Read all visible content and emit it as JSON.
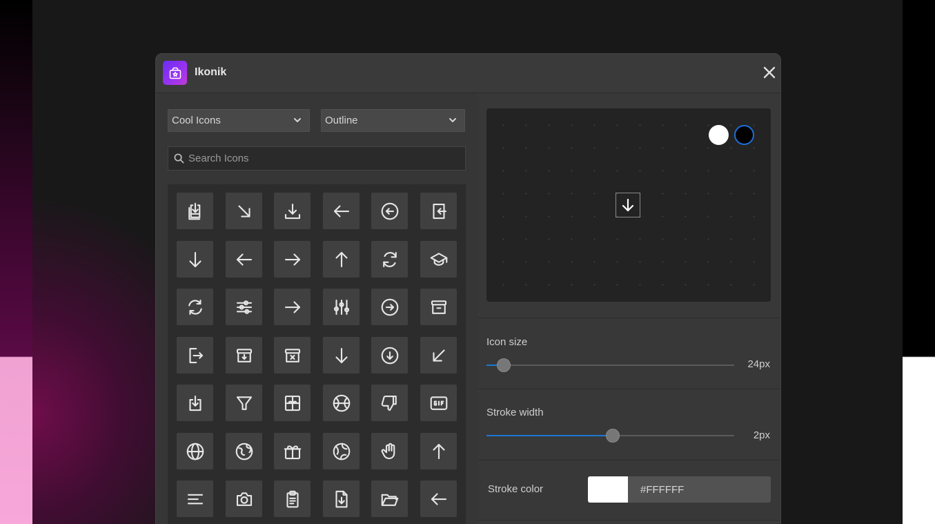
{
  "app": {
    "title": "Ikonik",
    "logo_icon": "package-star-icon",
    "close_icon": "close-icon"
  },
  "filters": {
    "library": {
      "selected": "Cool Icons"
    },
    "style": {
      "selected": "Outline"
    }
  },
  "search": {
    "placeholder": "Search Icons"
  },
  "icon_grid": {
    "columns": 6,
    "rows": [
      [
        "download-tray-icon",
        "arrow-down-right-icon",
        "download-icon",
        "arrow-left-icon",
        "arrow-left-circle-icon",
        "log-in-icon"
      ],
      [
        "arrow-down-icon",
        "arrow-left-icon",
        "arrow-right-icon",
        "arrow-up-icon",
        "refresh-icon",
        "graduation-cap-icon"
      ],
      [
        "sync-icon",
        "sliders-horizontal-icon",
        "arrow-right-icon",
        "sliders-vertical-icon",
        "arrow-right-circle-icon",
        "archive-icon"
      ],
      [
        "log-out-icon",
        "archive-down-icon",
        "archive-x-icon",
        "arrow-down-icon",
        "arrow-down-circle-icon",
        "arrow-down-left-icon"
      ],
      [
        "download-box-icon",
        "filter-icon",
        "gift-box-icon",
        "basketball-icon",
        "thumbs-down-icon",
        "gif-icon"
      ],
      [
        "globe-icon",
        "earth-icon",
        "gift-icon",
        "globe-alt-icon",
        "hand-icon",
        "arrow-up-icon"
      ],
      [
        "align-left-icon",
        "camera-icon",
        "clipboard-icon",
        "file-download-icon",
        "folder-open-icon",
        "arrow-left-icon"
      ]
    ]
  },
  "preview": {
    "selected_icon": "arrow-down-icon",
    "background_options": [
      "#FFFFFF",
      "#000000"
    ],
    "selected_background": "#000000"
  },
  "settings": {
    "icon_size": {
      "label": "Icon size",
      "value_text": "24px",
      "fraction": 0.07
    },
    "stroke_width": {
      "label": "Stroke width",
      "value_text": "2px",
      "fraction": 0.51
    },
    "stroke_color": {
      "label": "Stroke color",
      "value": "#FFFFFF"
    }
  },
  "colors": {
    "accent": "#1B78D6",
    "window_bg": "#383838",
    "tile_bg": "#404040",
    "logo_gradient_start": "#6B2CF5",
    "logo_gradient_end": "#C23AD6"
  }
}
